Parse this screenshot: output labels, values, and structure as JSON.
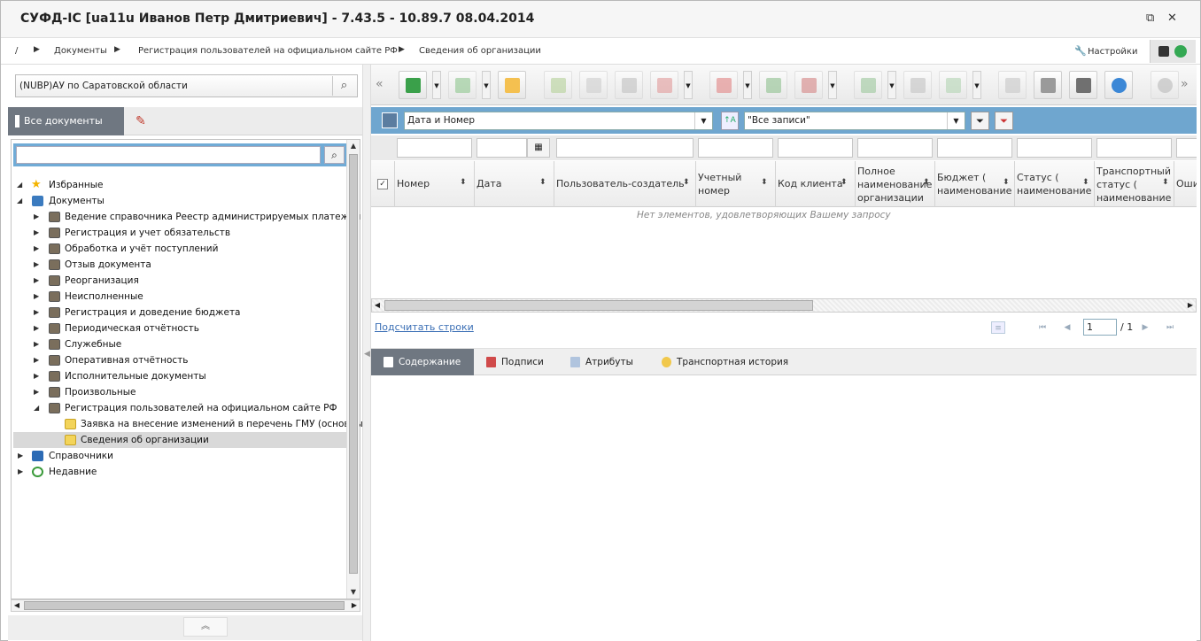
{
  "window": {
    "title": "СУФД-IC [ua11u Иванов Петр Дмитриевич] - 7.43.5 - 10.89.7 08.04.2014",
    "restore_label": "⧉",
    "close_label": "✕"
  },
  "breadcrumb": {
    "root": "/",
    "items": [
      "Документы",
      "Регистрация пользователей на официальном сайте РФ",
      "Сведения об организации"
    ],
    "settings_label": "Настройки"
  },
  "left": {
    "org": "(NUBP)АУ по Саратовской области",
    "tab_all_label": "Все документы",
    "tree": {
      "favorites": "Избранные",
      "documents": "Документы",
      "doc_children": [
        "Ведение справочника Реестр администрируемых платежей",
        "Регистрация и учет обязательств",
        "Обработка и учёт поступлений",
        "Отзыв документа",
        "Реорганизация",
        "Неисполненные",
        "Регистрация и доведение бюджета",
        "Периодическая отчётность",
        "Служебные",
        "Оперативная отчётность",
        "Исполнительные документы",
        "Произвольные",
        "Регистрация пользователей на официальном сайте РФ"
      ],
      "reg_children": [
        "Заявка на внесение изменений в перечень ГМУ (основны",
        "Сведения об организации"
      ],
      "references": "Справочники",
      "recent": "Недавние"
    }
  },
  "right": {
    "filter": {
      "sort_field": "Дата и Номер",
      "records_filter": "\"Все записи\""
    },
    "columns": [
      {
        "label": "Номер"
      },
      {
        "label": "Дата"
      },
      {
        "label": "Пользователь-создатель"
      },
      {
        "label": "Учетный номер"
      },
      {
        "label": "Код клиента"
      },
      {
        "label": "Полное наименование организации"
      },
      {
        "label": "Бюджет ( наименование"
      },
      {
        "label": "Статус ( наименование"
      },
      {
        "label": "Транспортный статус ( наименование"
      },
      {
        "label": "Оши"
      }
    ],
    "empty_message": "Нет элементов, удовлетворяющих Вашему запросу",
    "count_rows_link": "Подсчитать строки",
    "pager": {
      "current_page": "1",
      "total": "/ 1"
    },
    "bottom_tabs": [
      "Содержание",
      "Подписи",
      "Атрибуты",
      "Транспортная история"
    ]
  }
}
